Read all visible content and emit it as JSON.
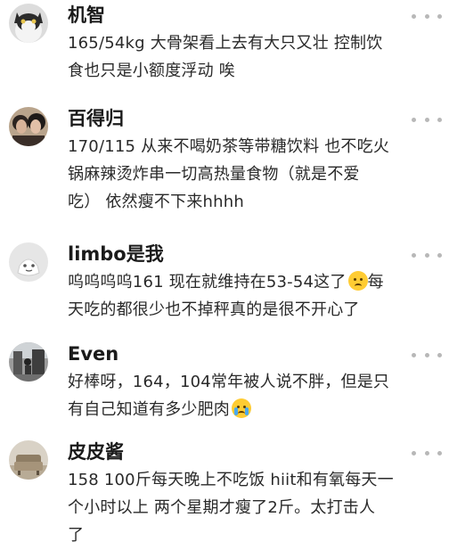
{
  "comments": [
    {
      "username": "机智",
      "lines": [
        "165/54kg 大骨架看上去有大只又壮 控制饮",
        "食也只是小额度浮动 唉"
      ]
    },
    {
      "username": "百得归",
      "lines": [
        "170/115 从来不喝奶茶等带糖饮料 也不吃火",
        "锅麻辣烫炸串一切高热量食物（就是不爱",
        "吃） 依然瘦不下来hhhh"
      ]
    },
    {
      "username": "limbo是我",
      "lines": [
        "呜呜呜呜161 现在就维持在53-54这了",
        "天吃的都很少也不掉秤真的是很不开心了"
      ],
      "line1_suffix": "每",
      "emoji": "disappointed-face-emoji"
    },
    {
      "username": "Even",
      "lines": [
        "好棒呀，164，104常年被人说不胖，但是只",
        "有自己知道有多少肥肉"
      ],
      "emoji": "loudly-crying-face-emoji"
    },
    {
      "username": "皮皮酱",
      "lines": [
        "158 100斤每天晚上不吃饭 hiit和有氧每天一",
        "个小时以上 两个星期才瘦了2斤。太打击人",
        "了"
      ]
    }
  ],
  "colors": {
    "text": "#2a2a2a",
    "username": "#1a1a1a",
    "more_dots": "#b8b8b8"
  },
  "icons": {
    "more": "more-dots-icon"
  }
}
